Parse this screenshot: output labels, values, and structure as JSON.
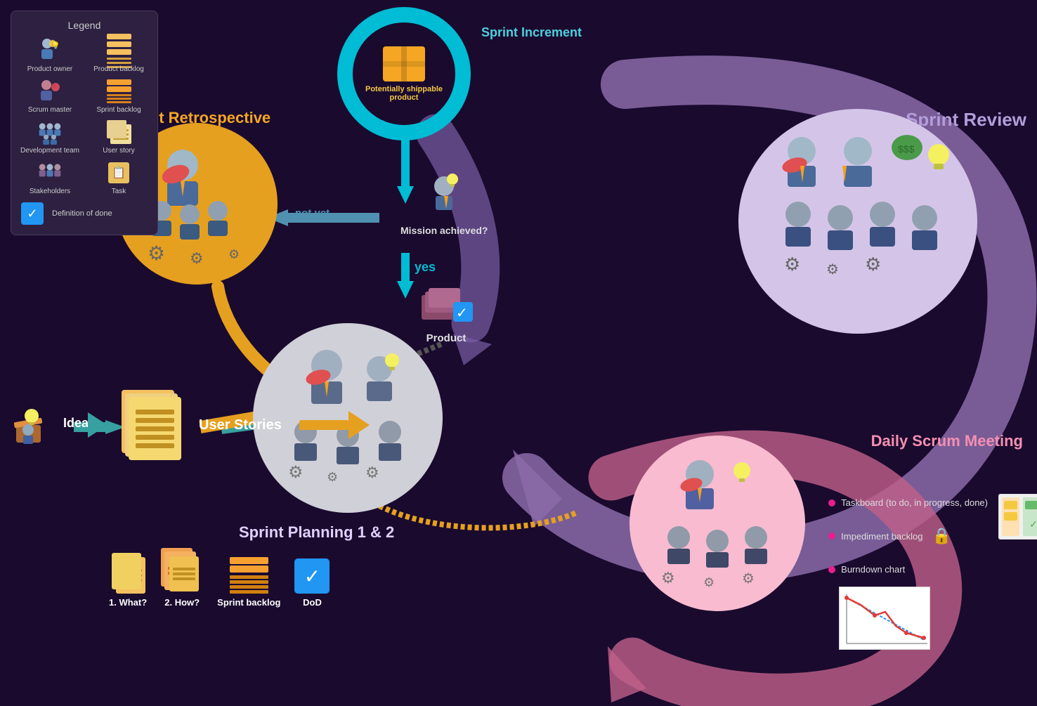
{
  "legend": {
    "title": "Legend",
    "items": [
      {
        "label": "Product owner",
        "icon": "person-lightbulb"
      },
      {
        "label": "Product backlog",
        "icon": "stacked-cards"
      },
      {
        "label": "Scrum master",
        "icon": "person-badge"
      },
      {
        "label": "Sprint backlog",
        "icon": "orange-stacked"
      },
      {
        "label": "Development team",
        "icon": "team-group"
      },
      {
        "label": "User story",
        "icon": "note-card"
      },
      {
        "label": "Stakeholders",
        "icon": "stakeholders"
      },
      {
        "label": "Task",
        "icon": "task-card"
      },
      {
        "label": "Definition of done",
        "icon": "dod-check"
      }
    ]
  },
  "sections": {
    "sprint_increment": {
      "label": "Sprint Increment",
      "inner_label": "Potentially shippable product"
    },
    "sprint_retrospective": {
      "label": "Sprint Retrospective"
    },
    "sprint_review": {
      "label": "Sprint Review"
    },
    "sprint_planning": {
      "label": "Sprint Planning 1 & 2",
      "items": [
        "1. What?",
        "2. How?",
        "Sprint backlog",
        "DoD"
      ]
    },
    "daily_scrum": {
      "label": "Daily Scrum Meeting",
      "legend_items": [
        "Taskboard (to do, in progress, done)",
        "Impediment backlog",
        "Burndown chart"
      ]
    },
    "mission": {
      "question": "Mission achieved?",
      "yes": "yes",
      "not_yet": "not yet"
    },
    "product": {
      "label": "Product"
    },
    "idea": {
      "label": "Idea"
    },
    "user_stories": {
      "label": "User Stories"
    }
  },
  "colors": {
    "teal": "#00bcd4",
    "orange": "#e6a020",
    "purple": "#7b5ea7",
    "pink": "#e91e8c",
    "light_purple": "#b39ddb",
    "light_pink": "#f48fb1",
    "background": "#1a0a2e",
    "review_arc": "#8B6BA8",
    "daily_arc": "#e91e8c"
  }
}
